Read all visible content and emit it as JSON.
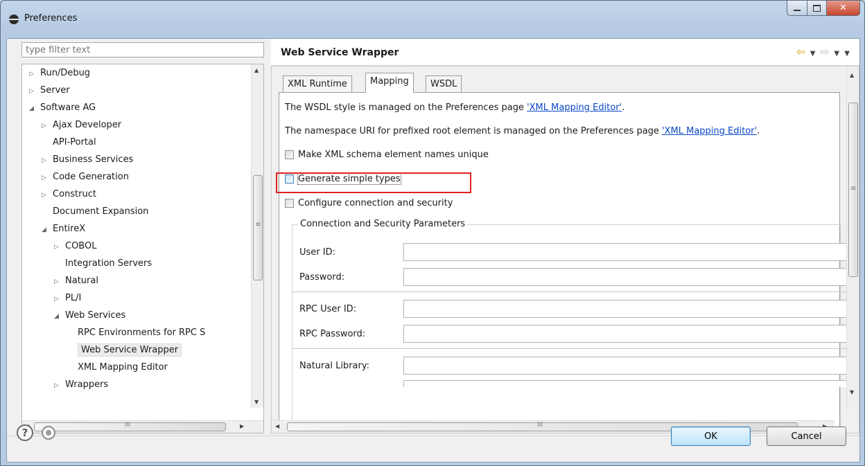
{
  "window": {
    "title": "Preferences"
  },
  "filter": {
    "placeholder": "type filter text"
  },
  "tree": {
    "items": [
      {
        "label": "Run/Debug",
        "level": 0,
        "expander": "collapsed"
      },
      {
        "label": "Server",
        "level": 0,
        "expander": "collapsed"
      },
      {
        "label": "Software AG",
        "level": 0,
        "expander": "expanded"
      },
      {
        "label": "Ajax Developer",
        "level": 1,
        "expander": "collapsed"
      },
      {
        "label": "API-Portal",
        "level": 1,
        "expander": "none"
      },
      {
        "label": "Business Services",
        "level": 1,
        "expander": "collapsed"
      },
      {
        "label": "Code Generation",
        "level": 1,
        "expander": "collapsed"
      },
      {
        "label": "Construct",
        "level": 1,
        "expander": "collapsed"
      },
      {
        "label": "Document Expansion",
        "level": 1,
        "expander": "none"
      },
      {
        "label": "EntireX",
        "level": 1,
        "expander": "expanded"
      },
      {
        "label": "COBOL",
        "level": 2,
        "expander": "collapsed"
      },
      {
        "label": "Integration Servers",
        "level": 2,
        "expander": "none"
      },
      {
        "label": "Natural",
        "level": 2,
        "expander": "collapsed"
      },
      {
        "label": "PL/I",
        "level": 2,
        "expander": "collapsed"
      },
      {
        "label": "Web Services",
        "level": 2,
        "expander": "expanded"
      },
      {
        "label": "RPC Environments for RPC S",
        "level": 3,
        "expander": "none"
      },
      {
        "label": "Web Service Wrapper",
        "level": 3,
        "expander": "none",
        "selected": true
      },
      {
        "label": "XML Mapping Editor",
        "level": 3,
        "expander": "none"
      },
      {
        "label": "Wrappers",
        "level": 2,
        "expander": "collapsed"
      }
    ]
  },
  "page": {
    "title": "Web Service Wrapper"
  },
  "tabs": [
    {
      "label": "XML Runtime",
      "active": false
    },
    {
      "label": "Mapping",
      "active": true
    },
    {
      "label": "WSDL",
      "active": false
    }
  ],
  "mapping": {
    "wsdl_style_text": "The WSDL style is managed on the Preferences page ",
    "wsdl_style_link": "'XML Mapping Editor'",
    "wsdl_style_end": ".",
    "namespace_text": "The namespace URI for prefixed root element is managed on the Preferences page ",
    "namespace_link": "'XML Mapping Editor'",
    "namespace_end": ".",
    "unique_names_label": "Make XML schema element names unique",
    "simple_types_label": "Generate simple types",
    "configure_label": "Configure connection and security",
    "group_title": "Connection and Security Parameters",
    "user_id_label": "User ID:",
    "password_label": "Password:",
    "rpc_user_id_label": "RPC User ID:",
    "rpc_password_label": "RPC Password:",
    "natural_library_label": "Natural Library:"
  },
  "buttons": {
    "ok": "OK",
    "cancel": "Cancel"
  },
  "icons": {
    "help": "?",
    "scroll_thumb": "III",
    "grip": "≡"
  },
  "colors": {
    "link": "#0645c8",
    "highlight": "#e02020",
    "default_button": "#bee6fd"
  }
}
